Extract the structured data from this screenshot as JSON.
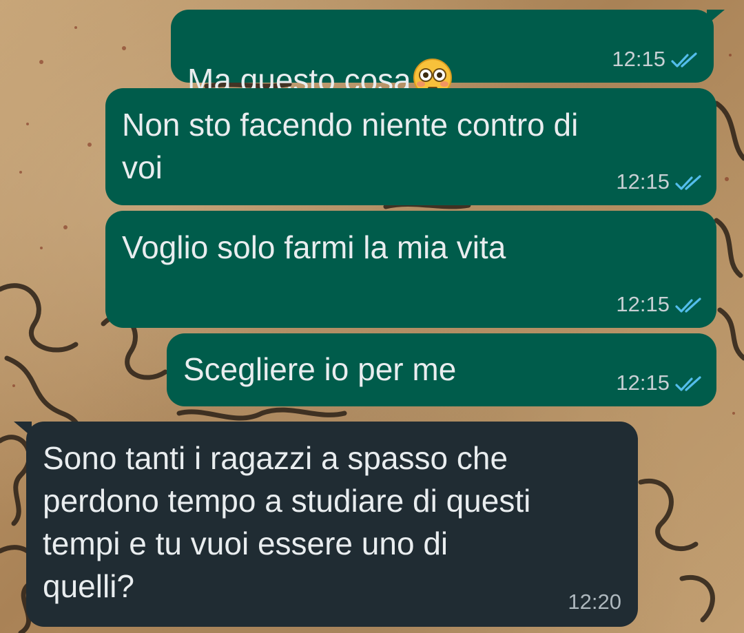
{
  "conversation": {
    "messages": [
      {
        "direction": "outgoing",
        "text": "Ma questo cosa",
        "emoji": "flushed-face-emoji",
        "time": "12:15",
        "status": "read-double-check-icon"
      },
      {
        "direction": "outgoing",
        "text": "Non sto facendo niente contro di\nvoi",
        "time": "12:15",
        "status": "read-double-check-icon"
      },
      {
        "direction": "outgoing",
        "text": "Voglio solo farmi la mia vita",
        "time": "12:15",
        "status": "read-double-check-icon"
      },
      {
        "direction": "outgoing",
        "text": "Scegliere io per me",
        "time": "12:15",
        "status": "read-double-check-icon"
      },
      {
        "direction": "incoming",
        "text": "Sono tanti i ragazzi a spasso che\nperdono tempo a studiare di questi\ntempi e tu vuoi essere uno di\nquelli?",
        "time": "12:20"
      }
    ]
  },
  "colors": {
    "outgoing_bubble": "#005c4b",
    "incoming_bubble": "#202c33",
    "message_text": "#e9edef",
    "read_ticks": "#53bdeb"
  }
}
